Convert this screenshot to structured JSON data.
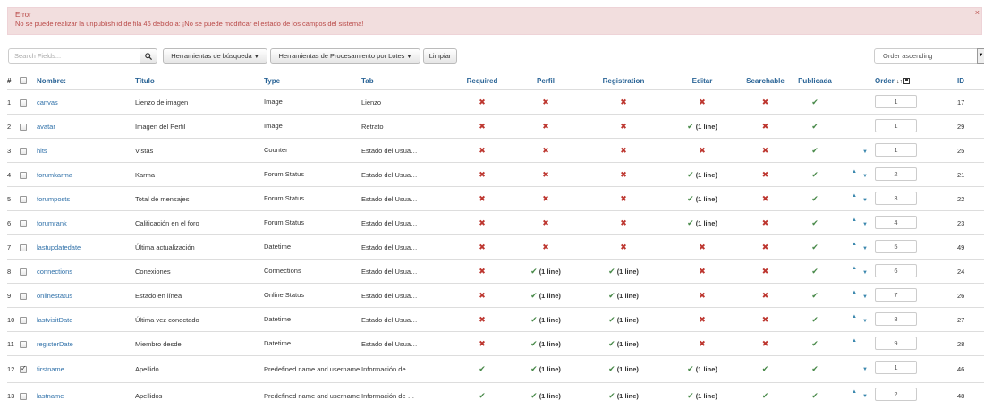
{
  "alert": {
    "title": "Error",
    "message": "No se puede realizar la unpublish id de fila 46 debido a: ¡No se puede modificar el estado de los campos del sistema!",
    "close": "×"
  },
  "toolbar": {
    "search_placeholder": "Search Fields...",
    "search_tools": "Herramientas de búsqueda",
    "batch_tools": "Herramientas de Procesamiento por Lotes",
    "clear": "Limpiar",
    "order_select": "Order ascending"
  },
  "columns": {
    "num": "#",
    "name": "Nombre:",
    "title": "Título",
    "type": "Type",
    "tab": "Tab",
    "required": "Required",
    "profile": "Perfil",
    "registration": "Registration",
    "edit": "Editar",
    "searchable": "Searchable",
    "published": "Publicada",
    "order": "Order",
    "id": "ID"
  },
  "yes_line_text": "(1 line)",
  "rows": [
    {
      "num": "1",
      "name": "canvas",
      "title": "Lienzo de imagen",
      "type": "Image",
      "tab": "Lienzo",
      "req": "no",
      "prof": "no",
      "reg": "no",
      "edit": "no",
      "search": "no",
      "pub": "yes",
      "up": false,
      "down": false,
      "order": "1",
      "id": "17",
      "checked": false
    },
    {
      "num": "2",
      "name": "avatar",
      "title": "Imagen del Perfil",
      "type": "Image",
      "tab": "Retrato",
      "req": "no",
      "prof": "no",
      "reg": "no",
      "edit": "line",
      "search": "no",
      "pub": "yes",
      "up": false,
      "down": false,
      "order": "1",
      "id": "29",
      "checked": false
    },
    {
      "num": "3",
      "name": "hits",
      "title": "Vistas",
      "type": "Counter",
      "tab": "Estado del Usua…",
      "req": "no",
      "prof": "no",
      "reg": "no",
      "edit": "no",
      "search": "no",
      "pub": "yes",
      "up": false,
      "down": true,
      "order": "1",
      "id": "25",
      "checked": false
    },
    {
      "num": "4",
      "name": "forumkarma",
      "title": "Karma",
      "type": "Forum Status",
      "tab": "Estado del Usua…",
      "req": "no",
      "prof": "no",
      "reg": "no",
      "edit": "line",
      "search": "no",
      "pub": "yes",
      "up": true,
      "down": true,
      "order": "2",
      "id": "21",
      "checked": false
    },
    {
      "num": "5",
      "name": "forumposts",
      "title": "Total de mensajes",
      "type": "Forum Status",
      "tab": "Estado del Usua…",
      "req": "no",
      "prof": "no",
      "reg": "no",
      "edit": "line",
      "search": "no",
      "pub": "yes",
      "up": true,
      "down": true,
      "order": "3",
      "id": "22",
      "checked": false
    },
    {
      "num": "6",
      "name": "forumrank",
      "title": "Calificación en el foro",
      "type": "Forum Status",
      "tab": "Estado del Usua…",
      "req": "no",
      "prof": "no",
      "reg": "no",
      "edit": "line",
      "search": "no",
      "pub": "yes",
      "up": true,
      "down": true,
      "order": "4",
      "id": "23",
      "checked": false
    },
    {
      "num": "7",
      "name": "lastupdatedate",
      "title": "Última actualización",
      "type": "Datetime",
      "tab": "Estado del Usua…",
      "req": "no",
      "prof": "no",
      "reg": "no",
      "edit": "no",
      "search": "no",
      "pub": "yes",
      "up": true,
      "down": true,
      "order": "5",
      "id": "49",
      "checked": false
    },
    {
      "num": "8",
      "name": "connections",
      "title": "Conexiones",
      "type": "Connections",
      "tab": "Estado del Usua…",
      "req": "no",
      "prof": "line",
      "reg": "line",
      "edit": "no",
      "search": "no",
      "pub": "yes",
      "up": true,
      "down": true,
      "order": "6",
      "id": "24",
      "checked": false
    },
    {
      "num": "9",
      "name": "onlinestatus",
      "title": "Estado en línea",
      "type": "Online Status",
      "tab": "Estado del Usua…",
      "req": "no",
      "prof": "line",
      "reg": "line",
      "edit": "no",
      "search": "no",
      "pub": "yes",
      "up": true,
      "down": true,
      "order": "7",
      "id": "26",
      "checked": false
    },
    {
      "num": "10",
      "name": "lastvisitDate",
      "title": "Última vez conectado",
      "type": "Datetime",
      "tab": "Estado del Usua…",
      "req": "no",
      "prof": "line",
      "reg": "line",
      "edit": "no",
      "search": "no",
      "pub": "yes",
      "up": true,
      "down": true,
      "order": "8",
      "id": "27",
      "checked": false
    },
    {
      "num": "11",
      "name": "registerDate",
      "title": "Miembro desde",
      "type": "Datetime",
      "tab": "Estado del Usua…",
      "req": "no",
      "prof": "line",
      "reg": "line",
      "edit": "no",
      "search": "no",
      "pub": "yes",
      "up": true,
      "down": false,
      "order": "9",
      "id": "28",
      "checked": false
    },
    {
      "num": "12",
      "name": "firstname",
      "title": "Apellido",
      "type": "Predefined name and username fields",
      "tab": "Información de …",
      "req": "yes",
      "prof": "line",
      "reg": "line",
      "edit": "line",
      "search": "yes",
      "pub": "yes",
      "up": false,
      "down": true,
      "order": "1",
      "id": "46",
      "checked": true
    },
    {
      "num": "13",
      "name": "lastname",
      "title": "Apellidos",
      "type": "Predefined name and username fields",
      "tab": "Información de …",
      "req": "yes",
      "prof": "line",
      "reg": "line",
      "edit": "line",
      "search": "yes",
      "pub": "yes",
      "up": true,
      "down": true,
      "order": "2",
      "id": "48",
      "checked": false
    }
  ]
}
